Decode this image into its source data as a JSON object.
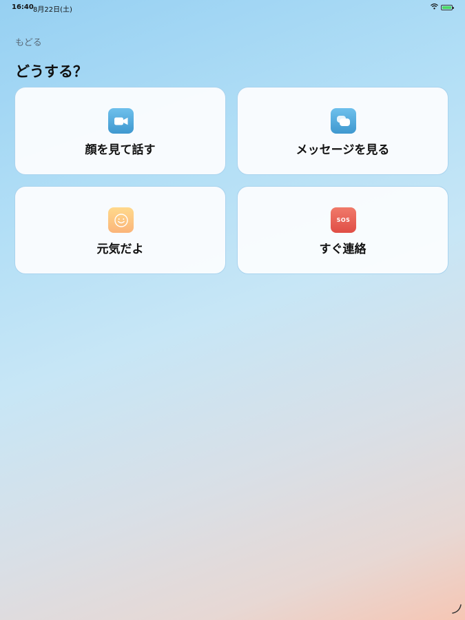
{
  "status_bar": {
    "time": "16:40",
    "date": "8月22日(土)",
    "icons": [
      "wifi-icon",
      "battery-charging-icon"
    ]
  },
  "back_label": "もどる",
  "title": "どうする？",
  "cards": [
    {
      "label": "顔を見て話す",
      "icon": "video-camera-icon",
      "color": "#4ea8dc"
    },
    {
      "label": "メッセージを見る",
      "icon": "chat-bubbles-icon",
      "color": "#4ea8dc"
    },
    {
      "label": "元気だよ",
      "icon": "smiley-face-icon",
      "color": "#fcc77f"
    },
    {
      "label": "すぐ連絡",
      "icon_text": "SOS",
      "icon": "sos-icon",
      "color": "#e8594f"
    }
  ],
  "colors": {
    "card_border": "#a9d3ee",
    "card_background": "#fafcfe"
  }
}
